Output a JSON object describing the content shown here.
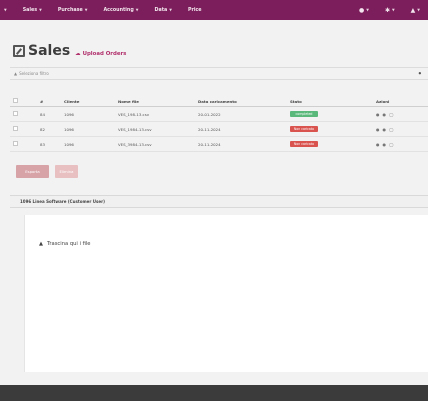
{
  "navbar": {
    "items": [
      {
        "label": "",
        "icon": "caret-down",
        "caret": true
      },
      {
        "label": "Sales",
        "caret": true
      },
      {
        "label": "Purchase",
        "caret": true
      },
      {
        "label": "Accounting",
        "caret": true
      },
      {
        "label": "Data",
        "caret": true
      },
      {
        "label": "Price",
        "caret": false
      }
    ],
    "right_icons": [
      "notification-icon",
      "settings-icon",
      "user-icon"
    ],
    "color": "#7b1e5b"
  },
  "page": {
    "title": "Sales",
    "title_icon": "edit-icon",
    "upload_label": "Upload Orders",
    "upload_icon": "cloud-upload-icon"
  },
  "filter": {
    "label": "Seleziona filtro",
    "right_icon": "columns-icon"
  },
  "table": {
    "columns": [
      "",
      "#",
      "Cliente",
      "Nome file",
      "Data caricamento",
      "Stato",
      "Azioni"
    ],
    "rows": [
      {
        "num": "84",
        "cliente": "1096",
        "file": "VES_198-13.csv",
        "date": "20-01-2022",
        "state": "completed",
        "state_color": "#59b87a"
      },
      {
        "num": "82",
        "cliente": "1096",
        "file": "VES_1984-13.csv",
        "date": "20-11-2024",
        "state": "Non caricato",
        "state_color": "#d9534f"
      },
      {
        "num": "83",
        "cliente": "1096",
        "file": "VES_3984-13.csv",
        "date": "20-11-2024",
        "state": "Non caricato",
        "state_color": "#d9534f"
      }
    ],
    "row_actions": [
      "view-icon",
      "edit-icon",
      "delete-icon"
    ]
  },
  "buttons": {
    "export_label": "Esporta",
    "delete_label": "Elimina"
  },
  "section": {
    "title": "1096 Linea Software (Customer User)"
  },
  "dropzone": {
    "icon": "upload-icon",
    "label": "Trascina qui i file"
  }
}
